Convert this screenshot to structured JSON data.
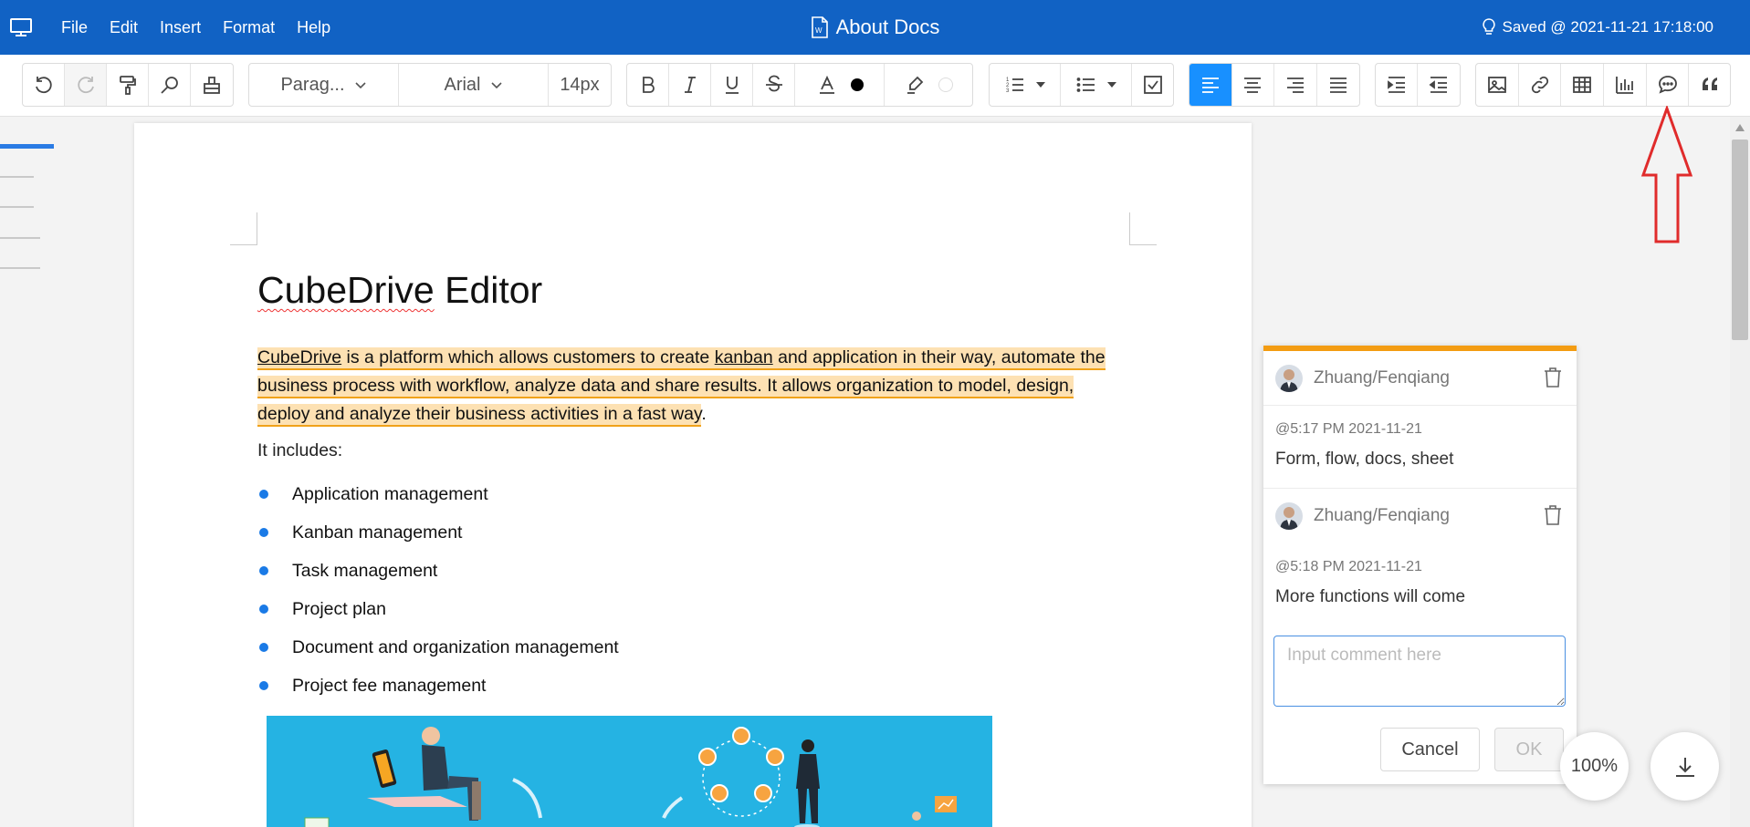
{
  "topbar": {
    "menu": [
      "File",
      "Edit",
      "Insert",
      "Format",
      "Help"
    ],
    "doc_title": "About Docs",
    "saved_text": "Saved @ 2021-11-21 17:18:00"
  },
  "toolbar": {
    "paragraph_select": "Parag...",
    "font_select": "Arial",
    "font_size": "14px",
    "accent_color": "#1890ff"
  },
  "document": {
    "heading_brand": "CubeDrive",
    "heading_rest": " Editor",
    "para_part1": "CubeDrive",
    "para_part2": " is a platform which allows customers to create ",
    "para_part3": "kanban",
    "para_part4": " and application in their way, automate the business process with workflow, analyze data and share results. It allows organization to model, design, deploy and analyze their business activities in a fast way",
    "para_part5": ".",
    "includes_label": "It includes:",
    "bullets": [
      "Application management",
      "Kanban management",
      "Task management",
      "Project plan",
      "Document and organization management",
      "Project fee management"
    ]
  },
  "comments": {
    "items": [
      {
        "author": "Zhuang/Fenqiang",
        "time": "@5:17 PM 2021-11-21",
        "text": "Form, flow, docs, sheet"
      },
      {
        "author": "Zhuang/Fenqiang",
        "time": "@5:18 PM 2021-11-21",
        "text": "More functions will come"
      }
    ],
    "input_placeholder": "Input comment here",
    "cancel_label": "Cancel",
    "ok_label": "OK",
    "highlight_color": "#f39c12"
  },
  "floating": {
    "zoom_label": "100%"
  }
}
